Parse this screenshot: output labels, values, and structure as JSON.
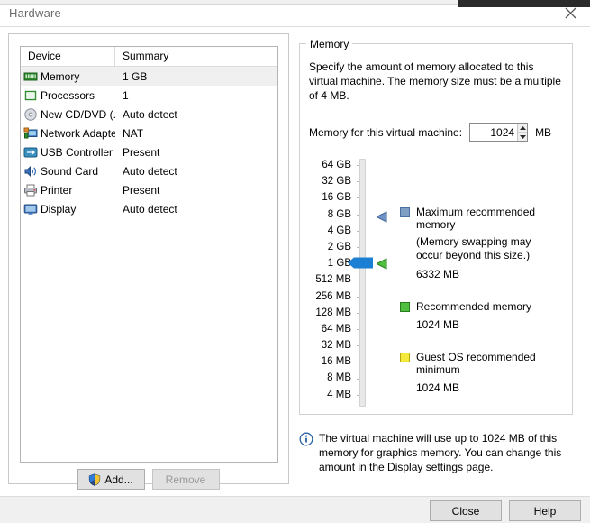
{
  "window": {
    "title": "Hardware",
    "close_icon": "close-icon"
  },
  "device_list": {
    "columns": [
      "Device",
      "Summary"
    ],
    "rows": [
      {
        "icon": "memory-module-icon",
        "device": "Memory",
        "summary": "1 GB",
        "selected": true
      },
      {
        "icon": "processor-chip-icon",
        "device": "Processors",
        "summary": "1",
        "selected": false
      },
      {
        "icon": "cd-dvd-disc-icon",
        "device": "New CD/DVD (...",
        "summary": "Auto detect",
        "selected": false
      },
      {
        "icon": "network-adapter-icon",
        "device": "Network Adapter",
        "summary": "NAT",
        "selected": false
      },
      {
        "icon": "usb-controller-icon",
        "device": "USB Controller",
        "summary": "Present",
        "selected": false
      },
      {
        "icon": "sound-card-icon",
        "device": "Sound Card",
        "summary": "Auto detect",
        "selected": false
      },
      {
        "icon": "printer-icon",
        "device": "Printer",
        "summary": "Present",
        "selected": false
      },
      {
        "icon": "display-monitor-icon",
        "device": "Display",
        "summary": "Auto detect",
        "selected": false
      }
    ]
  },
  "device_actions": {
    "add_label": "Add...",
    "add_icon": "shield-icon",
    "remove_label": "Remove",
    "remove_enabled": false
  },
  "memory_panel": {
    "group_title": "Memory",
    "description": "Specify the amount of memory allocated to this virtual machine. The memory size must be a multiple of 4 MB.",
    "input_label": "Memory for this virtual machine:",
    "input_value": "1024",
    "input_unit": "MB",
    "spin_up_icon": "chevron-up-icon",
    "spin_down_icon": "chevron-down-icon",
    "scale_labels": [
      "64 GB",
      "32 GB",
      "16 GB",
      "8 GB",
      "4 GB",
      "2 GB",
      "1 GB",
      "512 MB",
      "256 MB",
      "128 MB",
      "64 MB",
      "32 MB",
      "16 MB",
      "8 MB",
      "4 MB"
    ],
    "slider_thumb_icon": "slider-thumb-icon",
    "marker_max_icon": "left-arrow-marker-icon",
    "marker_recommended_icon": "left-arrow-marker-icon",
    "legend": [
      {
        "swatch": "blue",
        "title": "Maximum recommended memory",
        "note": "(Memory swapping may\noccur beyond this size.)",
        "value": "6332 MB"
      },
      {
        "swatch": "green",
        "title": "Recommended memory",
        "note": "",
        "value": "1024 MB"
      },
      {
        "swatch": "yellow",
        "title": "Guest OS recommended minimum",
        "note": "",
        "value": "1024 MB"
      }
    ],
    "info_icon": "info-icon",
    "info_text": "The virtual machine will use up to 1024 MB of this memory for graphics memory. You can change this amount in the Display settings page."
  },
  "footer": {
    "close_label": "Close",
    "help_label": "Help"
  },
  "colors": {
    "accent_blue": "#1b7fd4",
    "marker_blue": "#4a74b5",
    "marker_green": "#3ca02c",
    "swatch_blue": "#7f9ec4",
    "swatch_green": "#4fbf3f",
    "swatch_yellow": "#f5ea3c",
    "selection_row": "#f0f0f0",
    "title_text": "#6b6b6b"
  }
}
